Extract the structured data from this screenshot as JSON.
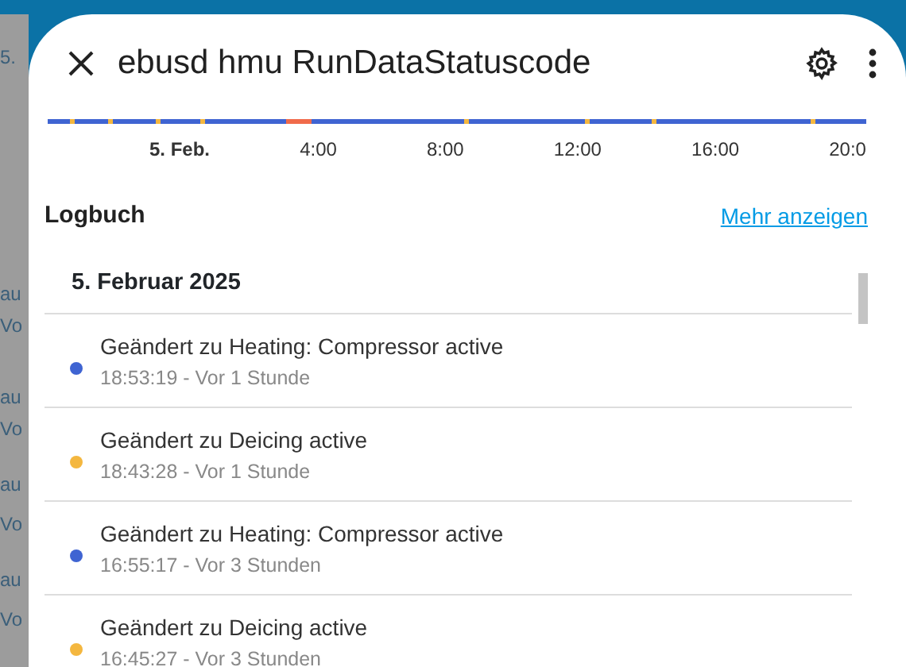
{
  "background": {
    "fragments": [
      "5.",
      "au",
      "Vo",
      "au",
      "Vo",
      "au",
      "Vo",
      "au",
      "Vo"
    ]
  },
  "dialog": {
    "title": "ebusd hmu RunDataStatuscode"
  },
  "timeline": {
    "labels": [
      {
        "text": "5. Feb.",
        "bold": true
      },
      {
        "text": "4:00",
        "bold": false
      },
      {
        "text": "8:00",
        "bold": false
      },
      {
        "text": "12:00",
        "bold": false
      },
      {
        "text": "16:00",
        "bold": false
      },
      {
        "text": "20:0",
        "bold": false
      }
    ]
  },
  "logbook": {
    "title": "Logbuch",
    "more_link": "Mehr anzeigen",
    "date": "5. Februar 2025",
    "entries": [
      {
        "text": "Geändert zu Heating: Compressor active",
        "time": "18:53:19 - Vor 1 Stunde",
        "color": "#3f64d2"
      },
      {
        "text": "Geändert zu Deicing active",
        "time": "18:43:28 - Vor 1 Stunde",
        "color": "#f4b73f"
      },
      {
        "text": "Geändert zu Heating: Compressor active",
        "time": "16:55:17 - Vor 3 Stunden",
        "color": "#3f64d2"
      },
      {
        "text": "Geändert zu Deicing active",
        "time": "16:45:27 - Vor 3 Stunden",
        "color": "#f4b73f"
      }
    ]
  }
}
